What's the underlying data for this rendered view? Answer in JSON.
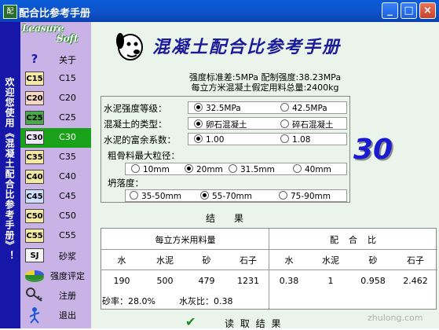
{
  "window": {
    "title": "配合比参考手册",
    "app_icon": "app-icon",
    "minimize": "_",
    "maximize": "□",
    "close": "×"
  },
  "left_banner": "欢迎您使用《混凝土配合比参考手册》！",
  "logo": {
    "line1": "Leasure",
    "line2": "Soft"
  },
  "sidebar": {
    "items": [
      {
        "icon": "?",
        "label": "关于"
      },
      {
        "icon": "C15",
        "label": "C15"
      },
      {
        "icon": "C20",
        "label": "C20"
      },
      {
        "icon": "C25",
        "label": "C25"
      },
      {
        "icon": "C30",
        "label": "C30"
      },
      {
        "icon": "C35",
        "label": "C35"
      },
      {
        "icon": "C40",
        "label": "C40"
      },
      {
        "icon": "C45",
        "label": "C45"
      },
      {
        "icon": "C50",
        "label": "C50"
      },
      {
        "icon": "C55",
        "label": "C55"
      },
      {
        "icon": "SJ",
        "label": "砂浆"
      },
      {
        "icon": "pie",
        "label": "强度评定"
      },
      {
        "icon": "key",
        "label": "注册"
      },
      {
        "icon": "exit",
        "label": "退出"
      }
    ],
    "selected": "C30"
  },
  "main": {
    "title": "混凝土配合比参考手册",
    "std_line1": "强度标准差:5MPa 配制强度:38.23MPa",
    "std_line2": "每立方米混凝土假定用料总量:2400kg",
    "big_number": "30",
    "cement_grade": {
      "label": "水泥强度等级：",
      "options": [
        "32.5MPa",
        "42.5MPa"
      ],
      "selected": 0
    },
    "concrete_type": {
      "label": "混凝土的类型：",
      "options": [
        "卵石混凝土",
        "碎石混凝土"
      ],
      "selected": 0
    },
    "surplus_coef": {
      "label": "水泥的富余系数：",
      "options": [
        "1.00",
        "1.08"
      ],
      "selected": 0
    },
    "max_aggregate": {
      "label": "粗骨料最大粒径：",
      "options": [
        "10mm",
        "20mm",
        "31.5mm",
        "40mm"
      ],
      "selected": 1
    },
    "slump": {
      "label": "坍落度：",
      "options": [
        "35-50mm",
        "55-70mm",
        "75-90mm"
      ],
      "selected": 1
    }
  },
  "results": {
    "title": "结　　果",
    "group1": "每立方米用料量",
    "group2": "配　合　比",
    "headers": [
      "水",
      "水泥",
      "砂",
      "石子",
      "水",
      "水泥",
      "砂",
      "石子"
    ],
    "values": [
      "190",
      "500",
      "479",
      "1231",
      "0.38",
      "1",
      "0.958",
      "2.462"
    ],
    "sand_ratio": "砂率：28.0%",
    "wc_ratio": "水灰比：0.38"
  },
  "read_button": "读 取 结 果",
  "watermark": "zhulong.com"
}
